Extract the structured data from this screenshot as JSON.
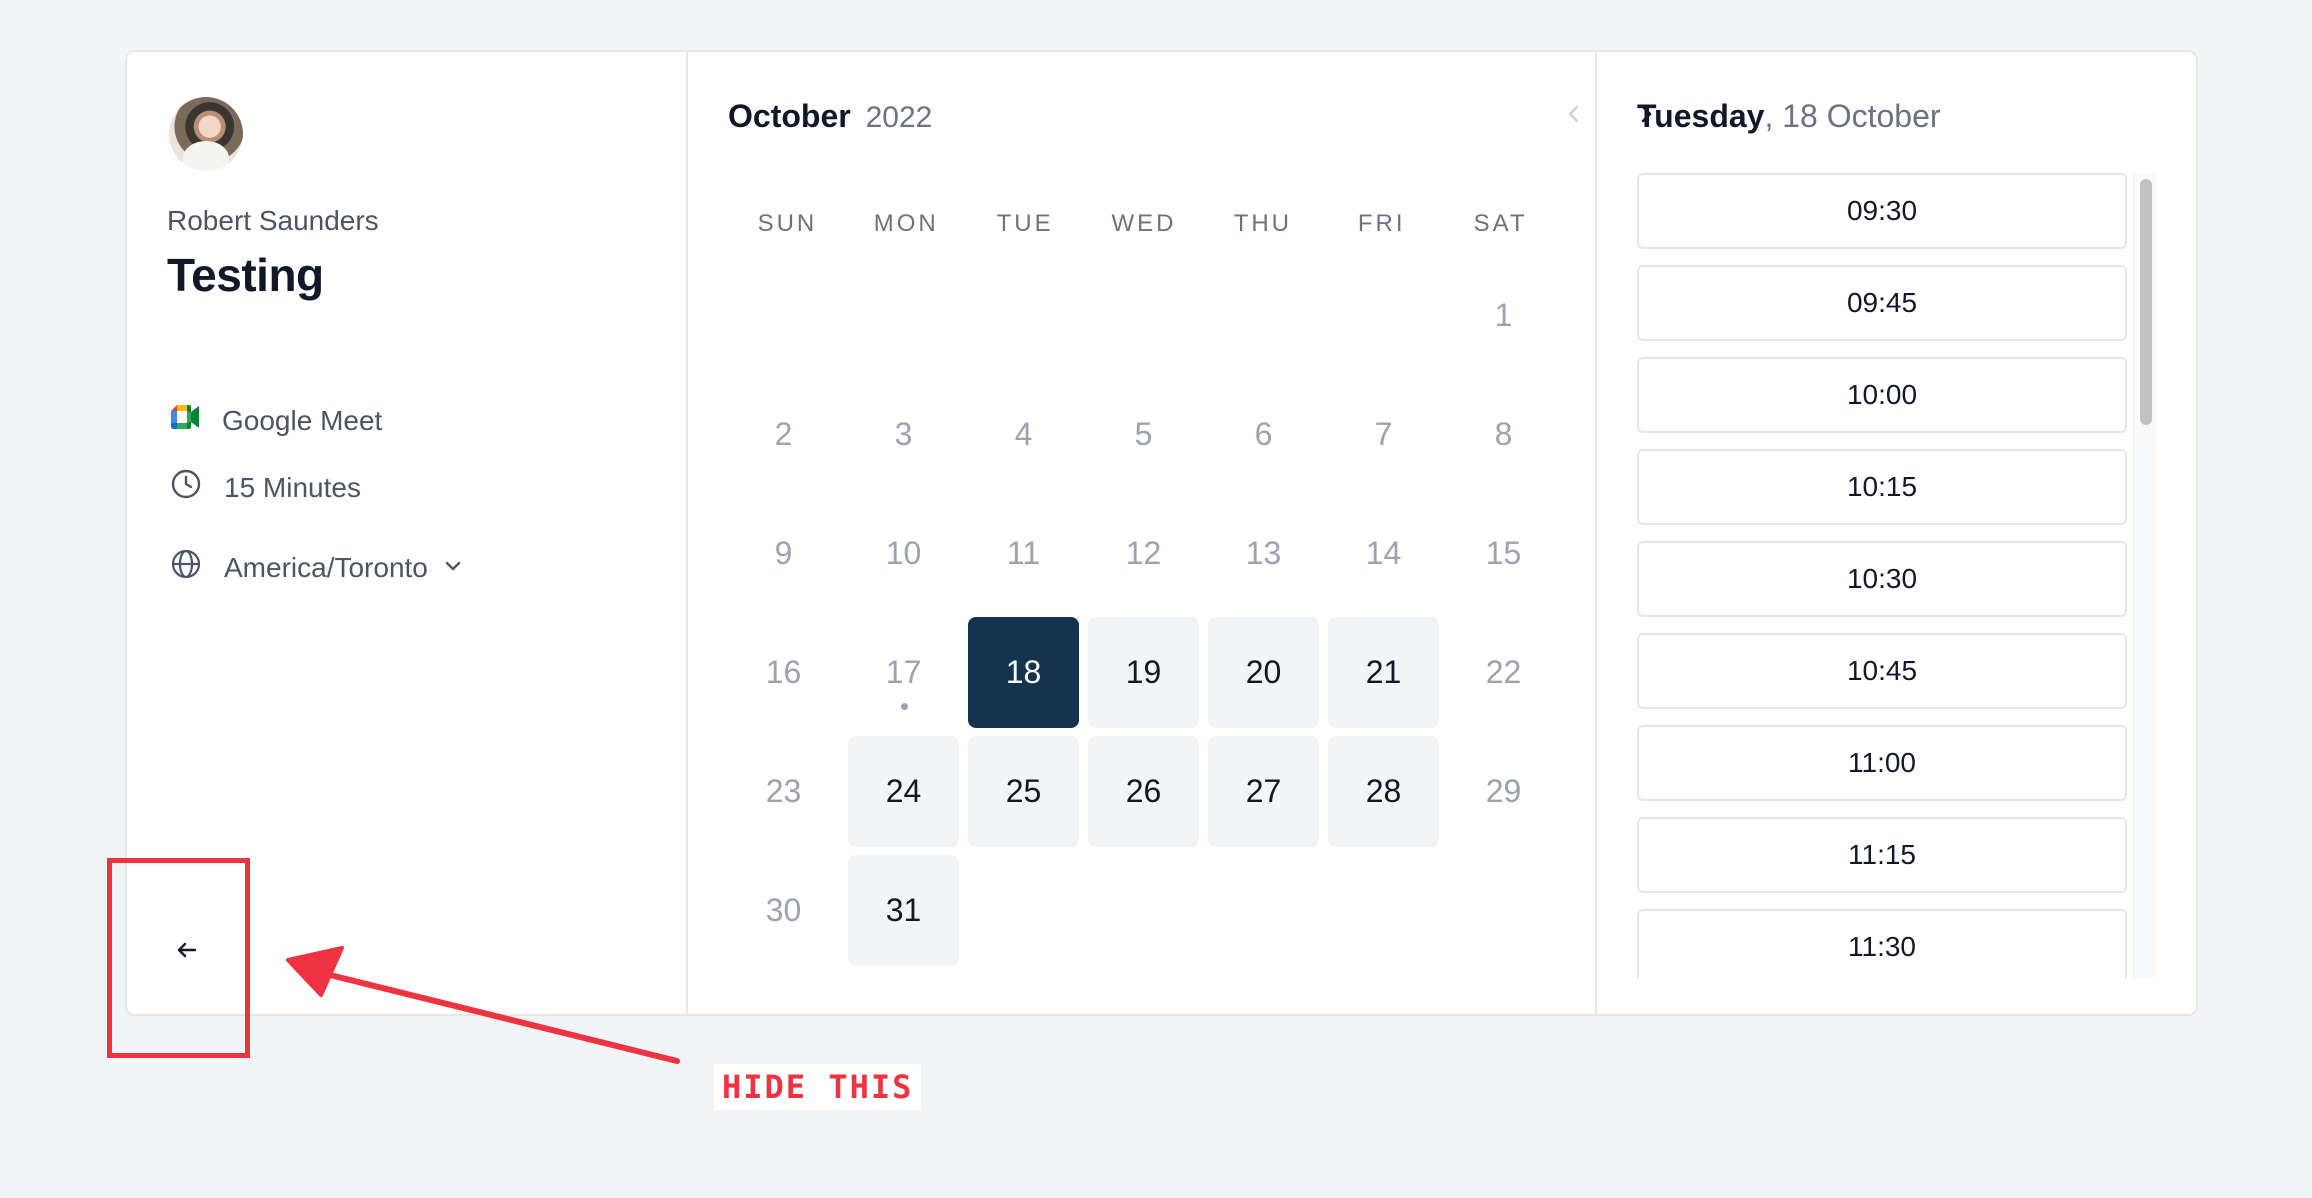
{
  "profile": {
    "owner_name": "Robert Saunders",
    "event_title": "Testing",
    "location": "Google Meet",
    "duration": "15 Minutes",
    "timezone": "America/Toronto"
  },
  "calendar": {
    "month": "October",
    "year": "2022",
    "weekdays": [
      "SUN",
      "MON",
      "TUE",
      "WED",
      "THU",
      "FRI",
      "SAT"
    ],
    "leading_blank_days": 6,
    "days": [
      {
        "day": "1",
        "state": "muted"
      },
      {
        "day": "2",
        "state": "muted"
      },
      {
        "day": "3",
        "state": "muted"
      },
      {
        "day": "4",
        "state": "muted"
      },
      {
        "day": "5",
        "state": "muted"
      },
      {
        "day": "6",
        "state": "muted"
      },
      {
        "day": "7",
        "state": "muted"
      },
      {
        "day": "8",
        "state": "muted"
      },
      {
        "day": "9",
        "state": "muted"
      },
      {
        "day": "10",
        "state": "muted"
      },
      {
        "day": "11",
        "state": "muted"
      },
      {
        "day": "12",
        "state": "muted"
      },
      {
        "day": "13",
        "state": "muted"
      },
      {
        "day": "14",
        "state": "muted"
      },
      {
        "day": "15",
        "state": "muted"
      },
      {
        "day": "16",
        "state": "muted"
      },
      {
        "day": "17",
        "state": "muted",
        "today": true
      },
      {
        "day": "18",
        "state": "selected"
      },
      {
        "day": "19",
        "state": "available"
      },
      {
        "day": "20",
        "state": "available"
      },
      {
        "day": "21",
        "state": "available"
      },
      {
        "day": "22",
        "state": "muted"
      },
      {
        "day": "23",
        "state": "muted"
      },
      {
        "day": "24",
        "state": "available"
      },
      {
        "day": "25",
        "state": "available"
      },
      {
        "day": "26",
        "state": "available"
      },
      {
        "day": "27",
        "state": "available"
      },
      {
        "day": "28",
        "state": "available"
      },
      {
        "day": "29",
        "state": "muted"
      },
      {
        "day": "30",
        "state": "muted"
      },
      {
        "day": "31",
        "state": "available"
      }
    ]
  },
  "slots_panel": {
    "weekday": "Tuesday",
    "date": ", 18 October",
    "times": [
      "09:30",
      "09:45",
      "10:00",
      "10:15",
      "10:30",
      "10:45",
      "11:00",
      "11:15",
      "11:30"
    ]
  },
  "annotation": {
    "label": "HIDE THIS",
    "color": "#ef3340"
  },
  "colors": {
    "selected_day": "#14334f",
    "available_day": "#f3f4f6",
    "page_background": "#f3f4f6"
  },
  "icons": {
    "location": "google-meet-icon",
    "duration": "clock-icon",
    "timezone": "globe-icon",
    "timezone_toggle": "chevron-down-icon",
    "back": "arrow-left-icon",
    "prev_month": "chevron-left-icon",
    "next_month": "chevron-right-icon"
  }
}
